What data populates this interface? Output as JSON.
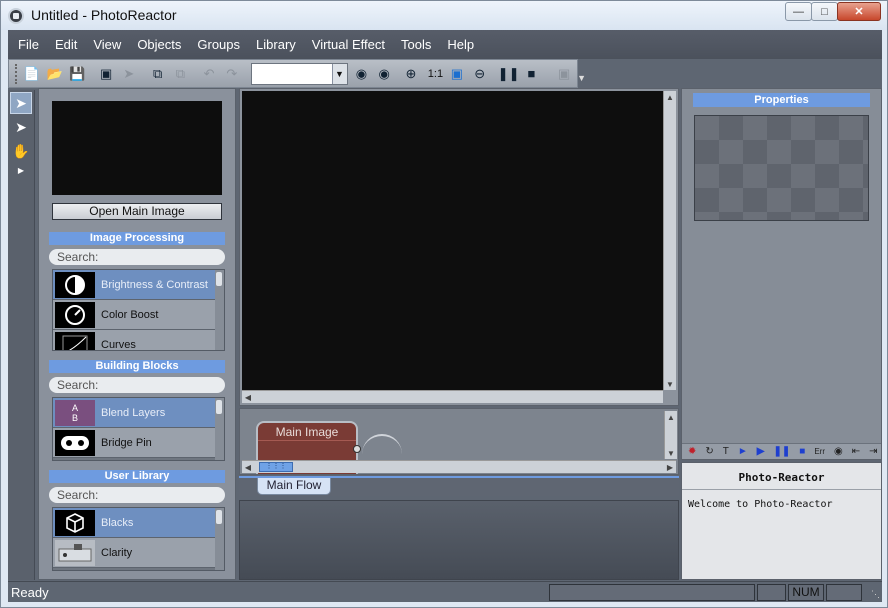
{
  "window": {
    "title": "Untitled - PhotoReactor"
  },
  "menu": [
    "File",
    "Edit",
    "View",
    "Objects",
    "Groups",
    "Library",
    "Virtual Effect",
    "Tools",
    "Help"
  ],
  "toolbar": {
    "zoom_actual": "1:1"
  },
  "left_panel": {
    "open_button": "Open Main Image",
    "image_processing": {
      "header": "Image Processing",
      "search": "Search:",
      "items": [
        "Brightness & Contrast",
        "Color Boost",
        "Curves"
      ]
    },
    "building_blocks": {
      "header": "Building Blocks",
      "search": "Search:",
      "items": [
        "Blend Layers",
        "Bridge Pin"
      ]
    },
    "user_library": {
      "header": "User Library",
      "search": "Search:",
      "items": [
        "Blacks",
        "Clarity"
      ]
    }
  },
  "flow": {
    "node_title": "Main Image",
    "tab": "Main Flow"
  },
  "properties": {
    "header": "Properties",
    "toolbar_err": "Err",
    "toolbar_t": "T"
  },
  "info": {
    "title": "Photo-Reactor",
    "message": "Welcome to Photo-Reactor"
  },
  "status": {
    "text": "Ready",
    "num": "NUM"
  },
  "colors": {
    "accent": "#6e9be0",
    "node": "#7a3b35"
  }
}
